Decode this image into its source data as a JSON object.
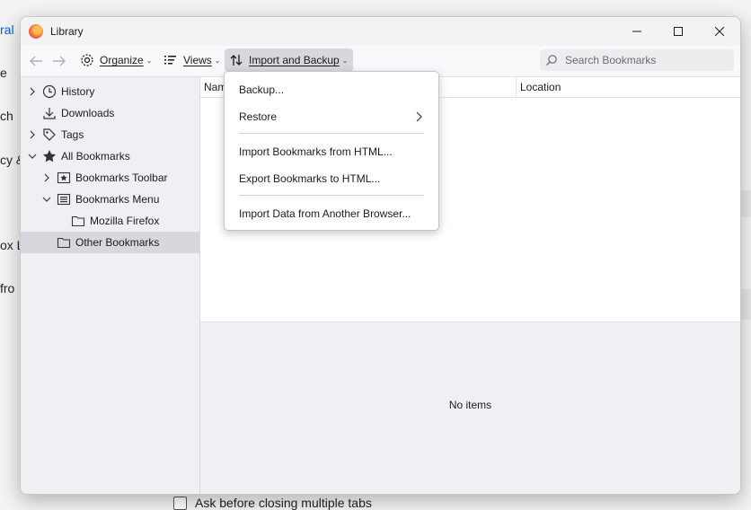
{
  "background": {
    "fragments": [
      "ral",
      "e",
      "ch",
      "cy &",
      "ox L",
      "fro"
    ],
    "checkbox_label": "Ask before closing multiple tabs"
  },
  "window": {
    "title": "Library"
  },
  "toolbar": {
    "organize_label": "Organize",
    "views_label": "Views",
    "import_backup_label": "Import and Backup",
    "search_placeholder": "Search Bookmarks"
  },
  "sidebar": {
    "items": [
      {
        "label": "History",
        "icon": "clock-icon",
        "twisty": "collapsed"
      },
      {
        "label": "Downloads",
        "icon": "download-icon",
        "twisty": "none"
      },
      {
        "label": "Tags",
        "icon": "tag-icon",
        "twisty": "collapsed"
      },
      {
        "label": "All Bookmarks",
        "icon": "star-icon",
        "twisty": "expanded"
      },
      {
        "label": "Bookmarks Toolbar",
        "icon": "bookmarks-toolbar-icon",
        "twisty": "collapsed"
      },
      {
        "label": "Bookmarks Menu",
        "icon": "bookmarks-menu-icon",
        "twisty": "expanded"
      },
      {
        "label": "Mozilla Firefox",
        "icon": "folder-icon",
        "twisty": "none"
      },
      {
        "label": "Other Bookmarks",
        "icon": "folder-icon",
        "twisty": "none",
        "selected": true
      }
    ]
  },
  "list": {
    "columns": [
      "Nam",
      "Location"
    ],
    "empty_text": "No items"
  },
  "menu": {
    "items": [
      {
        "label": "Backup...",
        "has_submenu": false
      },
      {
        "label": "Restore",
        "has_submenu": true
      },
      {
        "label": "Import Bookmarks from HTML...",
        "has_submenu": false
      },
      {
        "label": "Export Bookmarks to HTML...",
        "has_submenu": false
      },
      {
        "label": "Import Data from Another Browser...",
        "has_submenu": false
      }
    ]
  },
  "colors": {
    "accent_link": "#0060df",
    "selected_bg": "#d7d7de",
    "sidebar_bg": "#f0f0f4"
  }
}
